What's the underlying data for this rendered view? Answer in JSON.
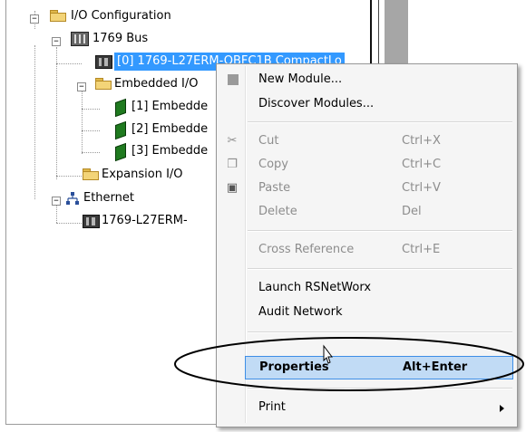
{
  "tree": {
    "io_configuration": "I/O Configuration",
    "bus_1769": "1769 Bus",
    "controller": "[0] 1769-L27ERM-QBFC1B CompactLo",
    "embedded_io": "Embedded I/O",
    "embedded_1": "[1] Embedde",
    "embedded_2": "[2] Embedde",
    "embedded_3": "[3] Embedde",
    "expansion_io": "Expansion I/O",
    "ethernet": "Ethernet",
    "ethernet_controller": "1769-L27ERM-"
  },
  "menu": {
    "new_module": "New Module...",
    "discover_modules": "Discover Modules...",
    "cut": "Cut",
    "cut_shortcut": "Ctrl+X",
    "copy": "Copy",
    "copy_shortcut": "Ctrl+C",
    "paste": "Paste",
    "paste_shortcut": "Ctrl+V",
    "delete": "Delete",
    "delete_shortcut": "Del",
    "cross_reference": "Cross Reference",
    "cross_reference_shortcut": "Ctrl+E",
    "launch_rsnetworx": "Launch RSNetWorx",
    "audit_network": "Audit Network",
    "properties": "Properties",
    "properties_shortcut": "Alt+Enter",
    "print": "Print"
  },
  "colors": {
    "selection": "#3399ff",
    "menu_hover": "#c1dbf5",
    "menu_hover_border": "#3d8ee6",
    "disabled_text": "#8d8d8d"
  },
  "icons": [
    "collapse-icon",
    "folder-icon",
    "backplane-icon",
    "controller-icon",
    "io-module-icon",
    "ethernet-icon",
    "cut-icon",
    "copy-icon",
    "paste-icon",
    "new-module-icon",
    "submenu-arrow-icon",
    "mouse-cursor-icon"
  ]
}
